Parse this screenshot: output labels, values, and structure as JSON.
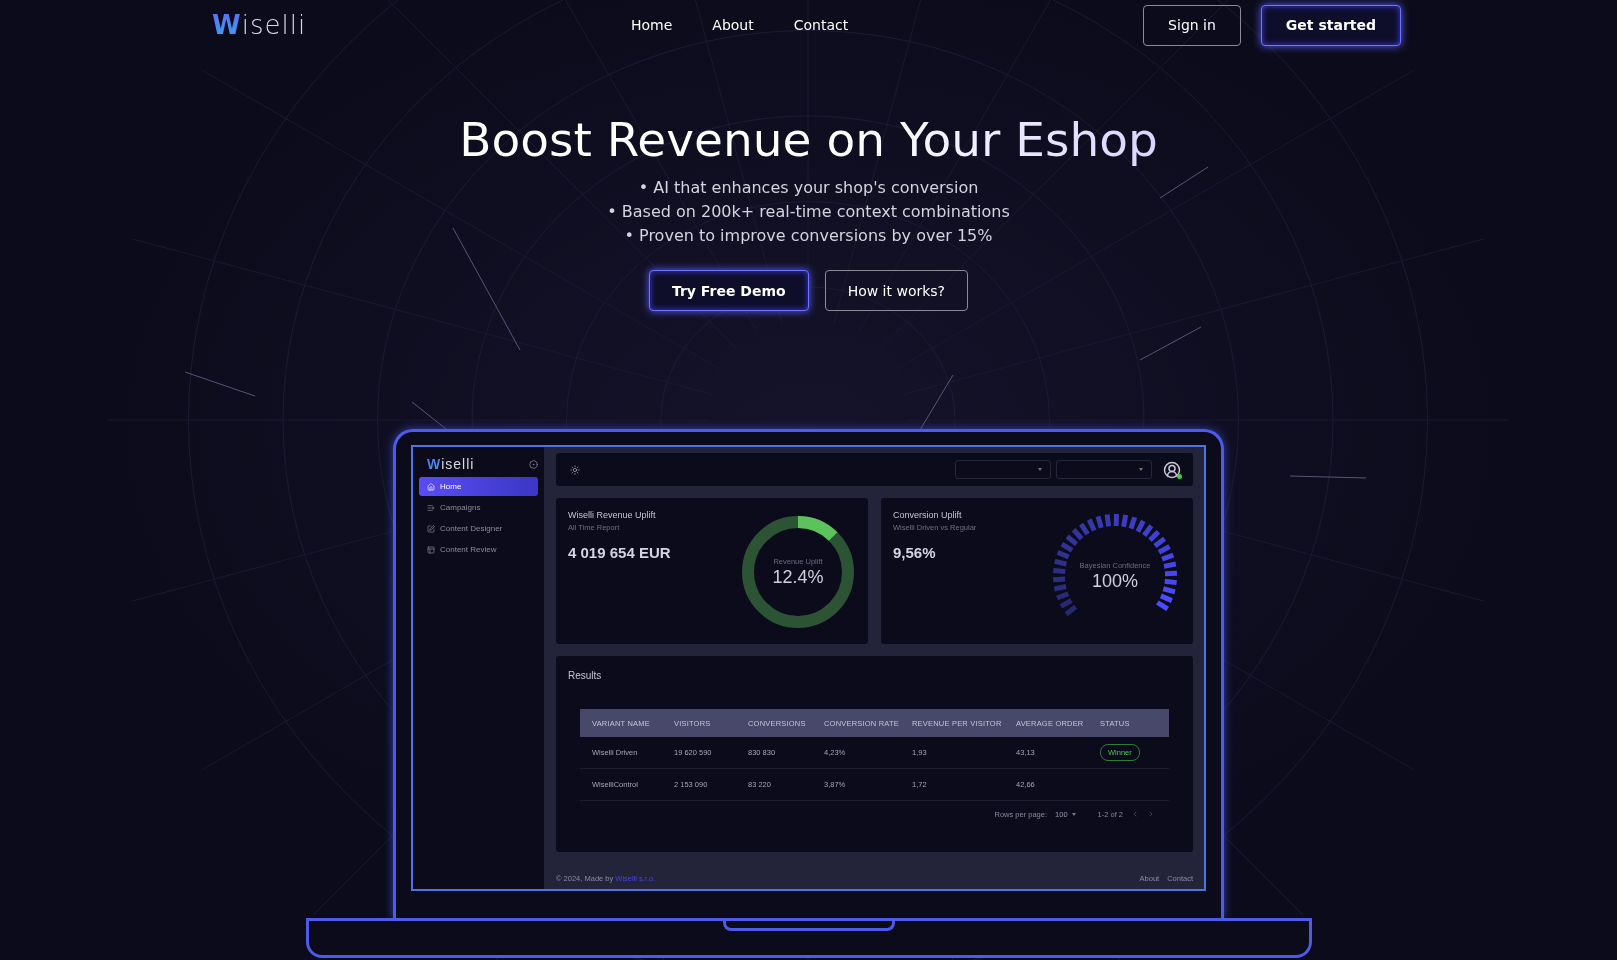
{
  "header": {
    "logo": "Wiselli",
    "nav": [
      {
        "label": "Home"
      },
      {
        "label": "About"
      },
      {
        "label": "Contact"
      }
    ],
    "actions": [
      {
        "label": "Sign in",
        "kind": "outline"
      },
      {
        "label": "Get started",
        "kind": "primary"
      }
    ]
  },
  "hero": {
    "title": "Boost Revenue on Your Eshop",
    "bullets": [
      "• AI that enhances your shop's conversion",
      "• Based on 200k+ real-time context combinations",
      "• Proven to improve conversions by over 15%"
    ],
    "buttons": [
      {
        "label": "Try Free Demo",
        "kind": "primary"
      },
      {
        "label": "How it works?",
        "kind": "outline"
      }
    ]
  },
  "dashboard": {
    "sidebar": {
      "logo": "Wiselli",
      "items": [
        {
          "label": "Home",
          "selected": true
        },
        {
          "label": "Campaigns",
          "selected": false
        },
        {
          "label": "Content Designer",
          "selected": false
        },
        {
          "label": "Content Review",
          "selected": false
        }
      ]
    },
    "top_bar": {
      "avatar_online": true
    },
    "cards": [
      {
        "title": "Wiselli Revenue Uplift",
        "subtitle": "All Time Report",
        "value": "4 019 654 EUR",
        "kind": "donut",
        "gauge_label": "Revenue Uplift",
        "gauge_value": "12.4%",
        "level": 0.124
      },
      {
        "title": "Conversion Uplift",
        "subtitle": "Wiselli Driven vs Regular",
        "value": "9,56%",
        "kind": "dial",
        "gauge_label": "Bayesian Confidence",
        "gauge_value": "100%"
      }
    ],
    "results": {
      "title": "Results",
      "columns": [
        "VARIANT NAME",
        "VISITORS",
        "CONVERSIONS",
        "CONVERSION RATE",
        "REVENUE PER VISITOR",
        "AVERAGE ORDER",
        "STATUS"
      ],
      "rows": [
        {
          "cells": [
            "Wiselli Driven",
            "19 620 590",
            "830 830",
            "4,23%",
            "1,93",
            "43,13"
          ],
          "status": "Winner"
        },
        {
          "cells": [
            "WiselliControl",
            "2 153 090",
            "83 220",
            "3,87%",
            "1,72",
            "42,66"
          ]
        }
      ],
      "pagination": {
        "rows_per_page_label": "Rows per page:",
        "rows_per_page": "100",
        "range": "1-2 of 2"
      }
    },
    "footer": {
      "copyright": "© 2024, Made by ",
      "company": "Wiselli s.r.o.",
      "links": [
        "About",
        "Contact"
      ]
    }
  }
}
